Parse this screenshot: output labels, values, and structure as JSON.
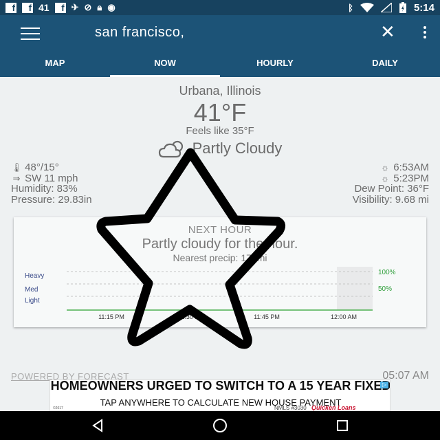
{
  "status_bar": {
    "notification_count": "41",
    "time": "5:14",
    "icons": [
      "facebook-icon",
      "facebook-icon",
      "facebook-icon",
      "gps-icon",
      "alarm-icon",
      "lock-icon",
      "game-icon",
      "bluetooth-icon",
      "wifi-icon",
      "signal-icon",
      "battery-icon"
    ]
  },
  "app_bar": {
    "search_value": "san francisco,",
    "tabs": [
      {
        "label": "MAP",
        "active": false
      },
      {
        "label": "NOW",
        "active": true
      },
      {
        "label": "HOURLY",
        "active": false
      },
      {
        "label": "DAILY",
        "active": false
      }
    ],
    "colors": {
      "status": "#17425f",
      "bar": "#1c5377"
    }
  },
  "current": {
    "location": "Urbana, Illinois",
    "temperature": "41°F",
    "feels_like": "Feels like 35°F",
    "condition": "Partly Cloudy",
    "condition_icon": "partly-cloudy-icon",
    "high_low": "48°/15°",
    "wind": "SW 11 mph",
    "humidity": "Humidity: 83%",
    "pressure": "Pressure: 29.83in",
    "sunrise": "6:53AM",
    "sunset": "5:23PM",
    "dew_point": "Dew Point: 36°F",
    "visibility": "Visibility: 9.68 mi"
  },
  "next_hour": {
    "title": "NEXT HOUR",
    "summary": "Partly cloudy for the hour.",
    "nearest": "Nearest precip: 173mi",
    "intensity_labels": [
      "Heavy",
      "Med",
      "Light"
    ],
    "percent_labels": [
      "100%",
      "50%"
    ],
    "time_labels": [
      "11:15 PM",
      "11:30 PM",
      "11:45 PM",
      "12:00 AM"
    ],
    "precip_line_color": "#4caf50"
  },
  "chart_data": {
    "type": "area",
    "title": "NEXT HOUR",
    "x": [
      "11:15 PM",
      "11:30 PM",
      "11:45 PM",
      "12:00 AM"
    ],
    "series": [
      {
        "values": [
          0,
          0,
          0,
          0
        ]
      }
    ],
    "y_category_labels": [
      "Heavy",
      "Med",
      "Light"
    ],
    "y_right_labels": [
      "100%",
      "50%"
    ],
    "grid": true
  },
  "footer": {
    "powered_by": "POWERED BY FORECAST",
    "updated_time": "05:07 AM"
  },
  "ad": {
    "headline": "HOMEOWNERS URGED TO SWITCH TO A 15 YEAR FIXED",
    "cta": "TAP ANYWHERE TO CALCULATE NEW HOUSE PAYMENT",
    "fine_print": "©2017",
    "nmls": "NMLS #3030",
    "brand": "Quicken Loans"
  },
  "nav_bar": {
    "buttons": [
      "back-icon",
      "home-icon",
      "recents-icon"
    ]
  }
}
